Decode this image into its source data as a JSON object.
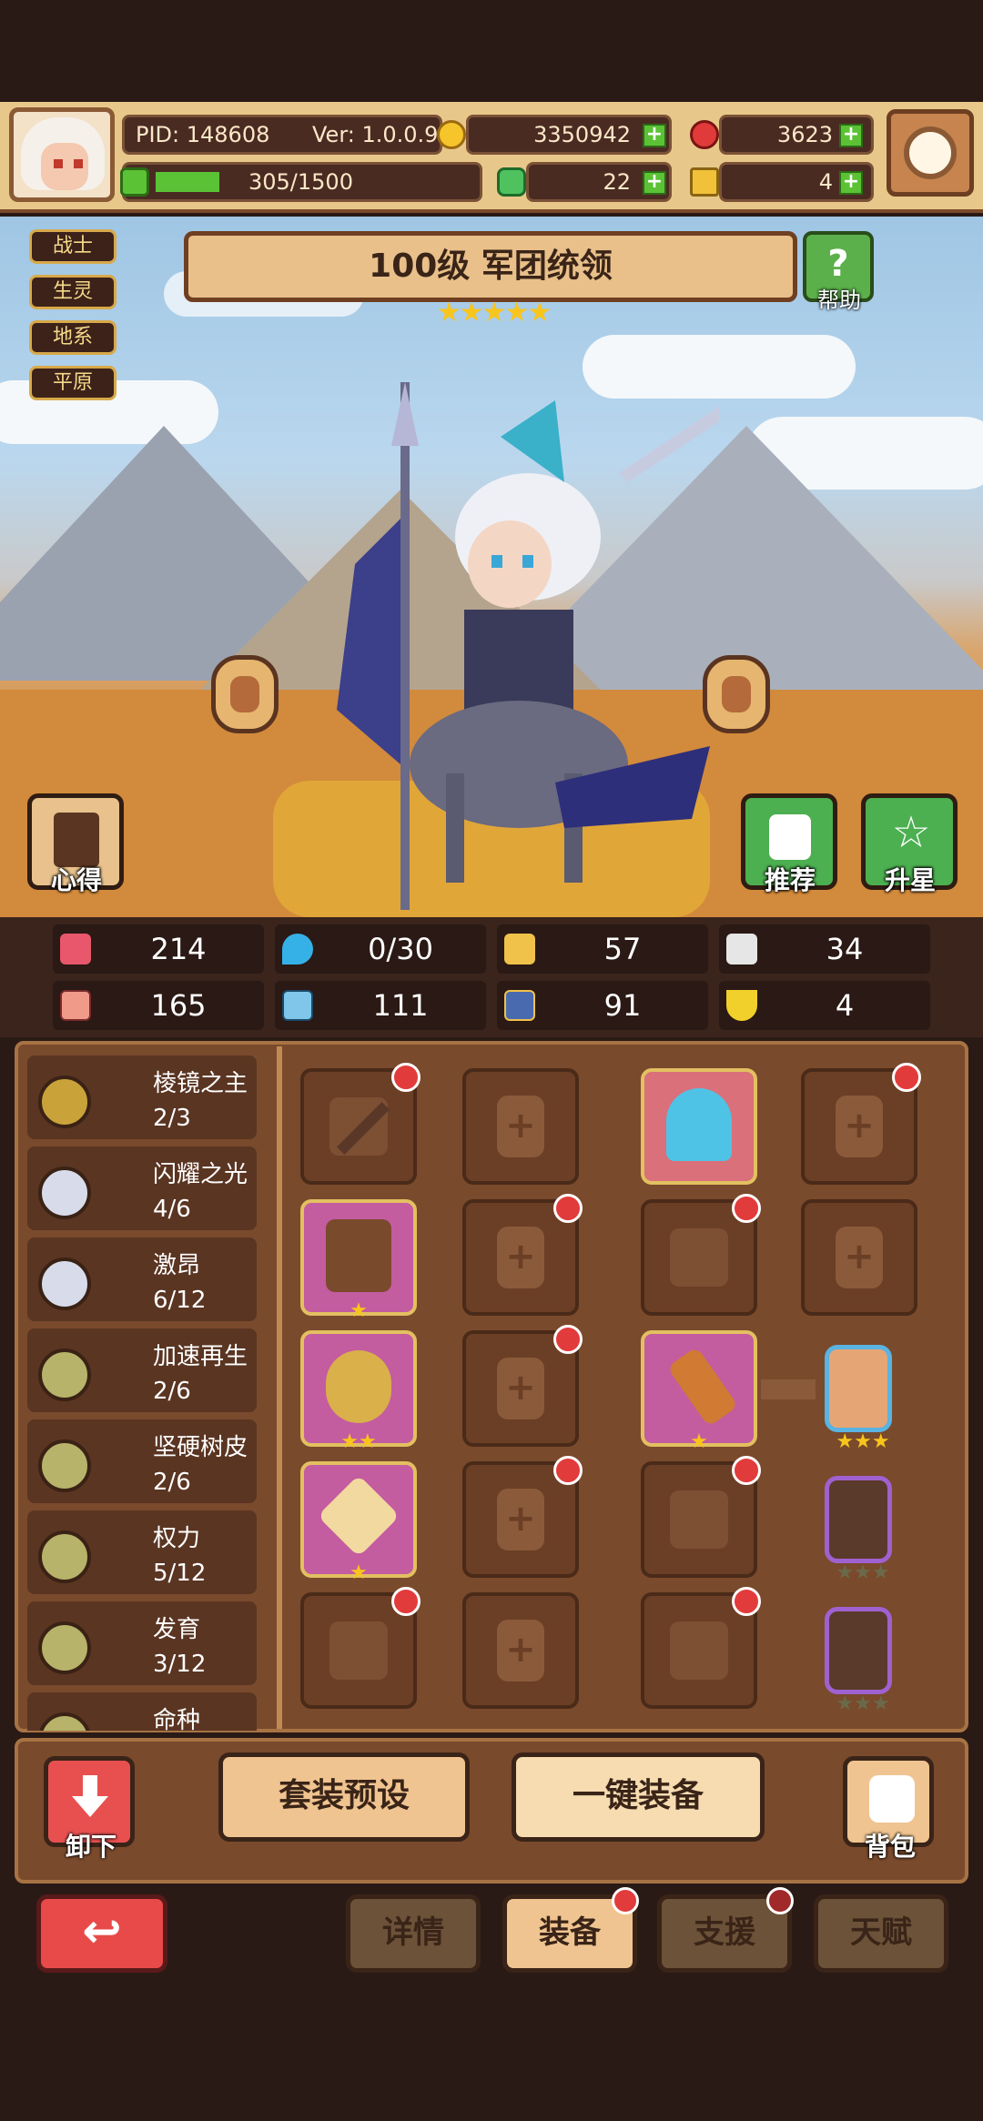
{
  "player": {
    "pid": "PID: 148608",
    "version": "Ver: 1.0.0.9",
    "exp": "305/1500",
    "exp_fraction": 0.2
  },
  "currencies": {
    "gold": "3350942",
    "gems": "3623",
    "clover": "22",
    "keys": "4"
  },
  "tags": [
    "战士",
    "生灵",
    "地系",
    "平原"
  ],
  "hero": {
    "title": "100级 军团统领",
    "stars": "★★★★★",
    "star_count": 5
  },
  "buttons": {
    "help": "帮助",
    "insight": "心得",
    "recommend": "推荐",
    "star_up": "升星",
    "unequip": "卸下",
    "preset": "套装预设",
    "auto_equip": "一键装备",
    "bag": "背包"
  },
  "stats": [
    {
      "icon": "heart-icon",
      "value": "214"
    },
    {
      "icon": "drop-icon",
      "value": "0/30"
    },
    {
      "icon": "shield-icon",
      "value": "57"
    },
    {
      "icon": "wing-icon",
      "value": "34"
    },
    {
      "icon": "fist-icon",
      "value": "165"
    },
    {
      "icon": "book-icon",
      "value": "111"
    },
    {
      "icon": "boot-icon",
      "value": "91"
    },
    {
      "icon": "magnet-icon",
      "value": "4"
    }
  ],
  "sets": [
    {
      "name": "棱镜之主",
      "count": "2/3",
      "color": "#c9a33a"
    },
    {
      "name": "闪耀之光",
      "count": "4/6",
      "color": "#d8dcea"
    },
    {
      "name": "激昂",
      "count": "6/12",
      "color": "#d8dcea"
    },
    {
      "name": "加速再生",
      "count": "2/6",
      "color": "#b7b36a"
    },
    {
      "name": "坚硬树皮",
      "count": "2/6",
      "color": "#b7b36a"
    },
    {
      "name": "权力",
      "count": "5/12",
      "color": "#b7b36a"
    },
    {
      "name": "发育",
      "count": "3/12",
      "color": "#b7b36a"
    },
    {
      "name": "命种",
      "count": "",
      "color": "#b7b36a"
    }
  ],
  "tabs": {
    "detail": "详情",
    "equip": "装备",
    "support": "支援",
    "talent": "天赋"
  },
  "colors": {
    "accent": "#f0c490",
    "alert": "#e23b3b",
    "panel": "#7a4a2c"
  }
}
